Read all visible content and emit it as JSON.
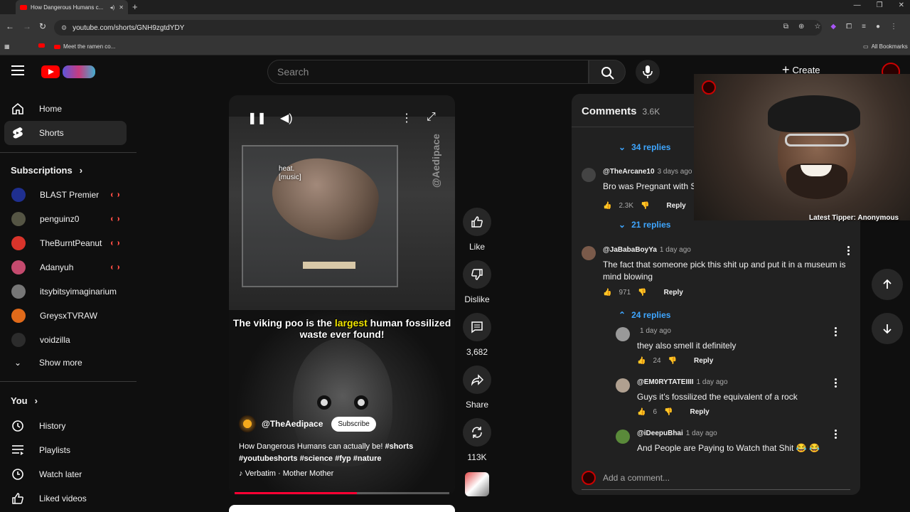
{
  "browser": {
    "tab_title": "How Dangerous Humans c...",
    "url": "youtube.com/shorts/GNH9zgtdYDY",
    "bookmark_item": "Meet the ramen co...",
    "all_bookmarks": "All Bookmarks"
  },
  "header": {
    "search_placeholder": "Search",
    "create_label": "Create"
  },
  "sidebar": {
    "home": "Home",
    "shorts": "Shorts",
    "subscriptions": "Subscriptions",
    "subs": [
      {
        "name": "BLAST Premier",
        "color": "#1f2f8f"
      },
      {
        "name": "penguinz0",
        "color": "#555544"
      },
      {
        "name": "TheBurntPeanut",
        "color": "#d9342b"
      },
      {
        "name": "Adanyuh",
        "color": "#c44a6e"
      },
      {
        "name": "itsybitsyimaginarium",
        "color": "#777777"
      },
      {
        "name": "GreysxTVRAW",
        "color": "#e06a1a"
      },
      {
        "name": "voidzilla",
        "color": "#2c2c2c"
      }
    ],
    "show_more": "Show more",
    "you": "You",
    "history": "History",
    "playlists": "Playlists",
    "watch_later": "Watch later",
    "liked": "Liked videos"
  },
  "video": {
    "caption_line1": "heat.",
    "caption_line2": "[music]",
    "watermark": "@Aedipace",
    "headline_pre": "The viking poo is the ",
    "headline_highlight": "largest",
    "headline_post": " human fossilized waste ever found!",
    "channel": "@TheAedipace",
    "subscribe": "Subscribe",
    "title": "How Dangerous Humans can actually be! ",
    "tags": "#shorts #youtubeshorts #science #fyp #nature",
    "music": "Verbatim · Mother Mother",
    "progress": 0.57
  },
  "actions": {
    "like": "Like",
    "dislike": "Dislike",
    "comments_count": "3,682",
    "share": "Share",
    "remix_count": "113K"
  },
  "comments": {
    "title": "Comments",
    "count": "3.6K",
    "replies_1": "34 replies",
    "items": [
      {
        "author": "@TheArcane10",
        "time": "3 days ago",
        "text": "Bro was Pregnant with S",
        "likes": "2.3K",
        "reply": "Reply",
        "replies": "21 replies"
      },
      {
        "author": "@JaBabaBoyYa",
        "time": "1 day ago",
        "text": "The fact that someone pick this shit up and put it in a museum is mind blowing",
        "likes": "971",
        "reply": "Reply",
        "replies": "24 replies"
      }
    ],
    "replies_list": [
      {
        "author": "",
        "time": "1 day ago",
        "text": "they also smell it definitely",
        "likes": "24",
        "reply": "Reply"
      },
      {
        "author": "@EM0RYTATEIIII",
        "time": "1 day ago",
        "text": "Guys it's fossilized the equivalent of a rock",
        "likes": "6",
        "reply": "Reply"
      },
      {
        "author": "@iDeepuBhai",
        "time": "1 day ago",
        "text": "And People are Paying to Watch that Shit 😂 😂",
        "likes": "",
        "reply": ""
      }
    ],
    "add_comment": "Add a comment..."
  },
  "overlay": {
    "tipper": "Latest Tipper: Anonymous"
  }
}
